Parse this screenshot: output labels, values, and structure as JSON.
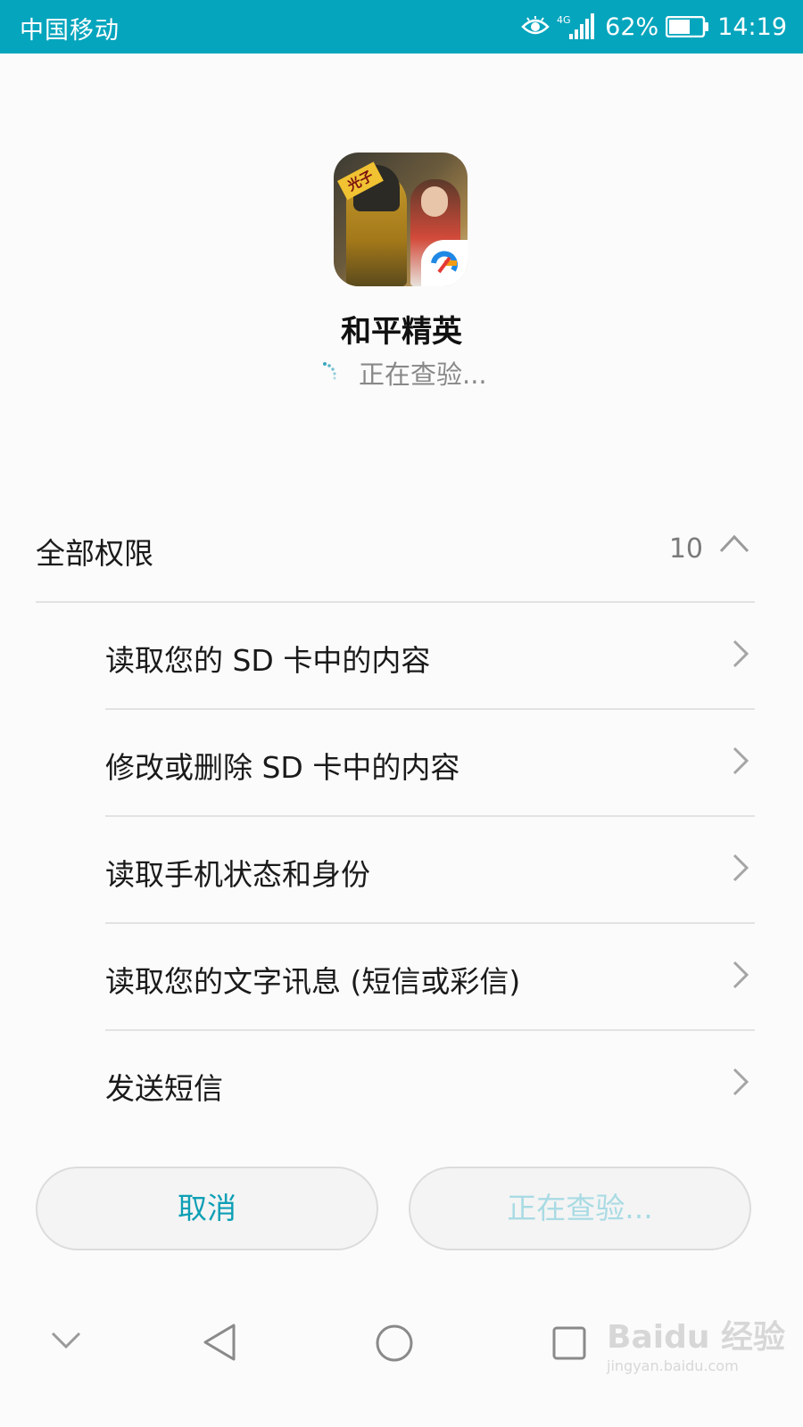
{
  "status_bar": {
    "carrier": "中国移动",
    "network": "4G",
    "battery_percent": "62%",
    "battery_level": 0.62,
    "time": "14:19",
    "background_color": "#05a5bd"
  },
  "app": {
    "name": "和平精英",
    "icon_tag": "光子",
    "status": "正在查验..."
  },
  "permissions": {
    "title": "全部权限",
    "count": "10",
    "items": [
      {
        "label": "读取您的 SD 卡中的内容"
      },
      {
        "label": "修改或删除 SD 卡中的内容"
      },
      {
        "label": "读取手机状态和身份"
      },
      {
        "label": "读取您的文字讯息 (短信或彩信)"
      },
      {
        "label": "发送短信"
      }
    ]
  },
  "buttons": {
    "cancel": "取消",
    "verify": "正在查验..."
  },
  "watermark": {
    "top": "Baidu 经验",
    "bottom": "jingyan.baidu.com"
  },
  "colors": {
    "accent": "#0d9fb5",
    "disabled_accent": "#a9dbe4"
  }
}
